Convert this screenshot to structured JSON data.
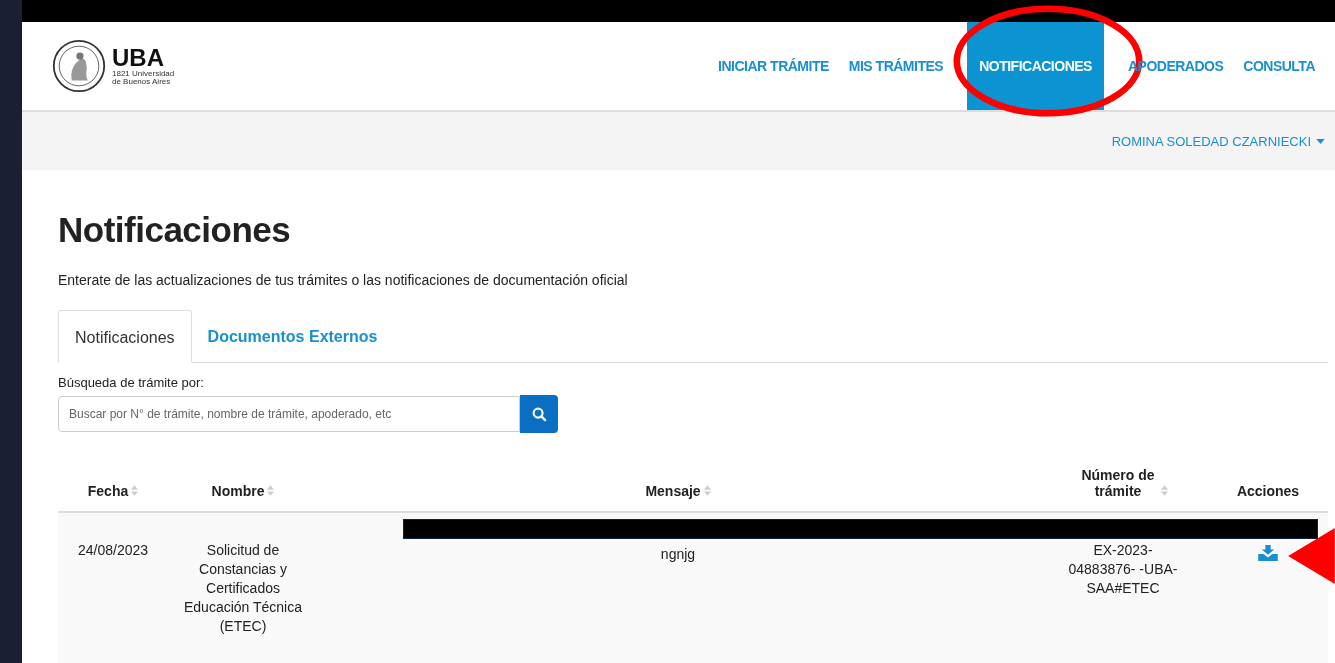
{
  "logo": {
    "title": "UBA",
    "subtitle": [
      "1821 Universidad",
      "de Buenos Aires"
    ]
  },
  "nav": [
    {
      "label": "INICIAR TRÁMITE",
      "selected": false
    },
    {
      "label": "MIS TRÁMITES",
      "selected": false
    },
    {
      "label": "NOTIFICACIONES",
      "selected": true
    },
    {
      "label": "APODERADOS",
      "selected": false
    },
    {
      "label": "CONSULTA",
      "selected": false
    }
  ],
  "user_menu": {
    "label": "ROMINA SOLEDAD CZARNIECKI"
  },
  "title": "Notificaciones",
  "description": "Enterate de las actualizaciones de tus trámites o las notificaciones de documentación oficial",
  "tabs": [
    {
      "label": "Notificaciones",
      "selected": true
    },
    {
      "label": "Documentos Externos",
      "selected": false
    }
  ],
  "search": {
    "label": "Búsqueda de trámite por:",
    "placeholder": "Buscar por N° de trámite, nombre de trámite, apoderado, etc"
  },
  "table": {
    "columns": [
      {
        "label": "Fecha",
        "sortable": true
      },
      {
        "label": "Nombre",
        "sortable": true
      },
      {
        "label": "Mensaje",
        "sortable": true
      },
      {
        "label": "Número de trámite",
        "sortable": true
      },
      {
        "label": "Acciones",
        "sortable": false
      }
    ],
    "rows": [
      {
        "fecha": "24/08/2023",
        "nombre": "Solicitud de Constancias y Certificados Educación Técnica (ETEC)",
        "mensaje": "ngnjg",
        "numero": "EX-2023-04883876- -UBA-SAA#ETEC"
      }
    ]
  }
}
